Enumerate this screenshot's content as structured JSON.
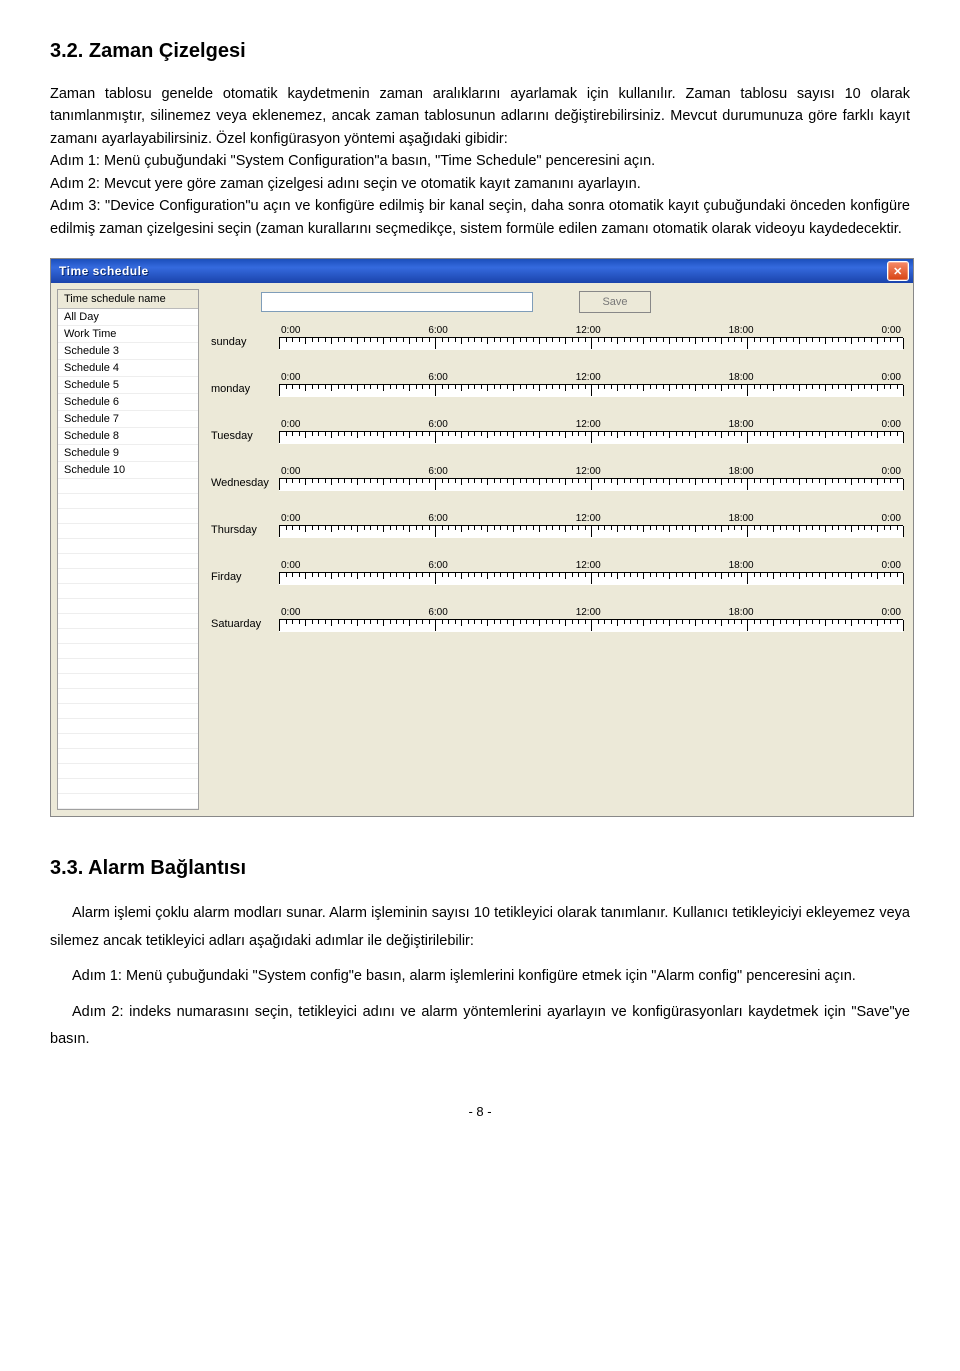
{
  "section1": {
    "heading": "3.2. Zaman Çizelgesi",
    "para": "Zaman tablosu genelde otomatik kaydetmenin zaman aralıklarını ayarlamak için kullanılır. Zaman tablosu sayısı 10 olarak tanımlanmıştır, silinemez veya eklenemez, ancak zaman tablosunun adlarını değiştirebilirsiniz. Mevcut durumunuza göre farklı kayıt zamanı ayarlayabilirsiniz. Özel konfigürasyon yöntemi aşağıdaki gibidir:",
    "step1": "Adım 1: Menü çubuğundaki \"System Configuration\"a basın, \"Time Schedule\" penceresini açın.",
    "step2": "Adım 2: Mevcut yere göre zaman çizelgesi adını seçin ve otomatik kayıt zamanını ayarlayın.",
    "step3": "Adım 3: \"Device Configuration\"u açın ve konfigüre edilmiş bir kanal seçin, daha sonra otomatik kayıt çubuğundaki önceden konfigüre edilmiş zaman çizelgesini seçin (zaman kurallarını seçmedikçe, sistem formüle edilen zamanı otomatik olarak videoyu kaydedecektir."
  },
  "window": {
    "title": "Time schedule",
    "close_label": "✕",
    "sidebar_header": "Time schedule name",
    "schedules": [
      "All Day",
      "Work Time",
      "Schedule 3",
      "Schedule 4",
      "Schedule 5",
      "Schedule 6",
      "Schedule 7",
      "Schedule 8",
      "Schedule 9",
      "Schedule 10"
    ],
    "save_label": "Save",
    "time_labels": [
      "0:00",
      "6:00",
      "12:00",
      "18:00",
      "0:00"
    ],
    "days": [
      "sunday",
      "monday",
      "Tuesday",
      "Wednesday",
      "Thursday",
      "Firday",
      "Satuarday"
    ]
  },
  "section2": {
    "heading": "3.3. Alarm Bağlantısı",
    "p1": "Alarm işlemi çoklu alarm modları sunar. Alarm işleminin sayısı 10 tetikleyici olarak tanımlanır. Kullanıcı tetikleyiciyi ekleyemez veya silemez ancak tetikleyici adları aşağıdaki adımlar ile değiştirilebilir:",
    "p2": "Adım 1: Menü çubuğundaki \"System config\"e basın, alarm işlemlerini konfigüre etmek için \"Alarm config\" penceresini açın.",
    "p3": "Adım 2: indeks numarasını seçin, tetikleyici adını ve alarm yöntemlerini ayarlayın ve konfigürasyonları kaydetmek için \"Save\"ye basın."
  },
  "page_number": "- 8 -"
}
